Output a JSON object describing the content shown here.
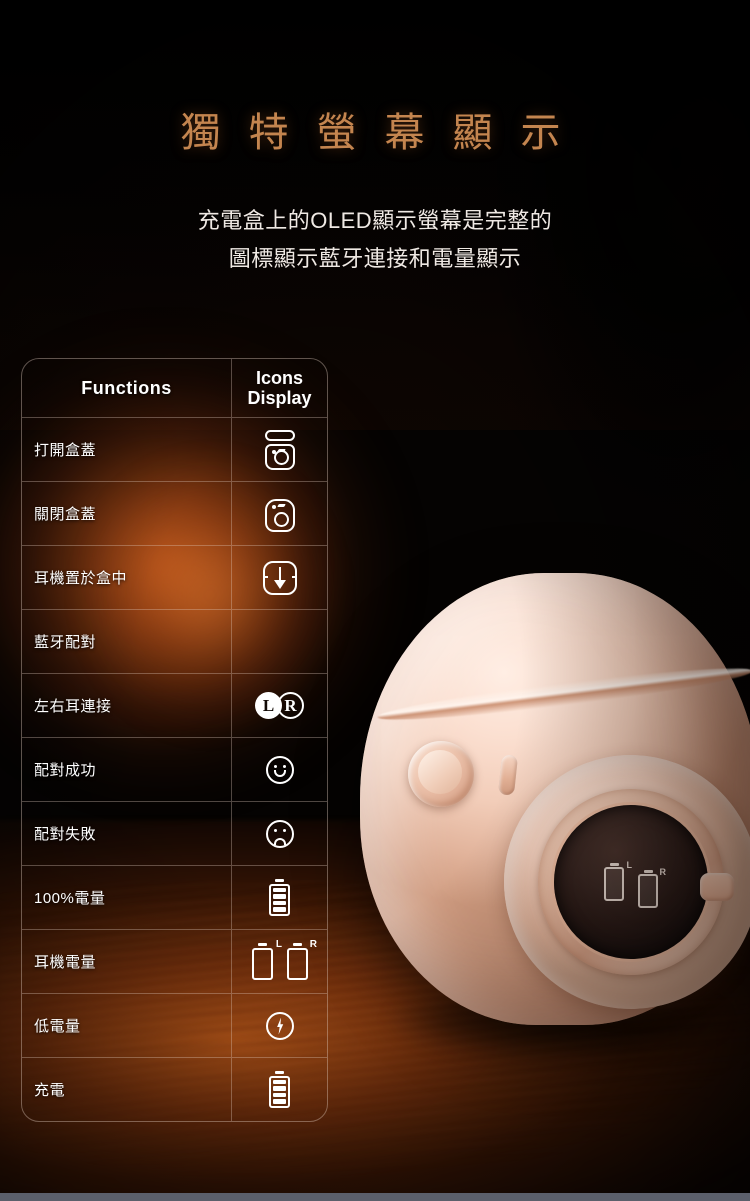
{
  "header": {
    "title": "獨 特 螢 幕 顯 示",
    "subtitle_line1": "充電盒上的OLED顯示螢幕是完整的",
    "subtitle_line2": "圖標顯示藍牙連接和電量顯示"
  },
  "table": {
    "columns": {
      "functions": "Functions",
      "icons_line1": "Icons",
      "icons_line2": "Display"
    },
    "rows": [
      {
        "function": "打開盒蓋",
        "icon_name": "case-open-icon"
      },
      {
        "function": "關閉盒蓋",
        "icon_name": "case-closed-icon"
      },
      {
        "function": "耳機置於盒中",
        "icon_name": "earbuds-in-case-icon"
      },
      {
        "function": "藍牙配對",
        "icon_name": "bluetooth-icon"
      },
      {
        "function": "左右耳連接",
        "icon_name": "left-right-earbud-icon"
      },
      {
        "function": "配對成功",
        "icon_name": "smiley-face-icon"
      },
      {
        "function": "配對失敗",
        "icon_name": "sad-face-icon"
      },
      {
        "function": "100%電量",
        "icon_name": "battery-full-icon"
      },
      {
        "function": "耳機電量",
        "icon_name": "earbud-battery-pair-icon"
      },
      {
        "function": "低電量",
        "icon_name": "low-battery-bolt-icon"
      },
      {
        "function": "充電",
        "icon_name": "battery-charging-icon"
      }
    ]
  },
  "icon_labels": {
    "bluetooth_glyph": "",
    "left": "L",
    "right": "R",
    "sup_left": "L",
    "sup_right": "R"
  },
  "product": {
    "oled_left_label": "L",
    "oled_right_label": "R"
  },
  "colors": {
    "title": "#c4854f",
    "subtitle": "#efe9e4",
    "table_text": "#ffffff",
    "table_border": "rgba(226,206,192,0.40)",
    "background": "#050302",
    "glow_warm": "#c45c1a",
    "product_body": "#f2cdb9",
    "bottom_strip": "#5b5f6b"
  }
}
